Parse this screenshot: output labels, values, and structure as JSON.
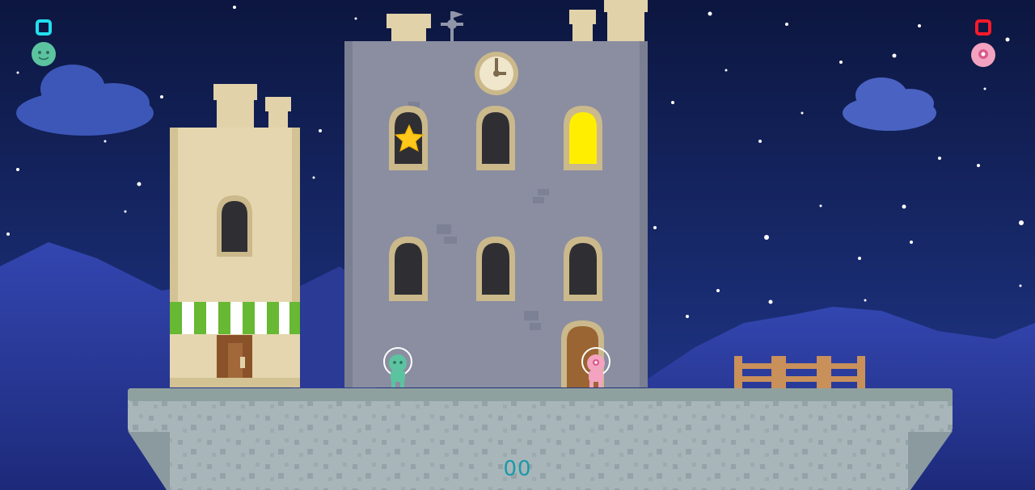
{
  "colors": {
    "sky_top": "#0c163f",
    "sky_bottom": "#223a92",
    "mountain": "#2a3a9a",
    "cloud": "#3d57b8",
    "tower_gray": "#8a8ea0",
    "tower_beige": "#e2d2aa",
    "window_lit": "#ffee00",
    "star": "#ffc81a",
    "platform": "#a9b7bb",
    "player_green": "#5cc3a0",
    "player_pink": "#f3a3bf",
    "player1_ring": "#22e0ee",
    "player2_ring": "#ff1a2a",
    "fence": "#c9905a"
  },
  "players": [
    {
      "name": "player-1",
      "color": "green",
      "marker": "cyan-square-icon"
    },
    {
      "name": "player-2",
      "color": "pink",
      "marker": "red-square-icon"
    }
  ],
  "hud": {
    "score": "00"
  },
  "objects": {
    "star_collected": false,
    "lit_window": "top-right",
    "clock": "clock-icon",
    "weathervane": "weathervane-icon"
  }
}
